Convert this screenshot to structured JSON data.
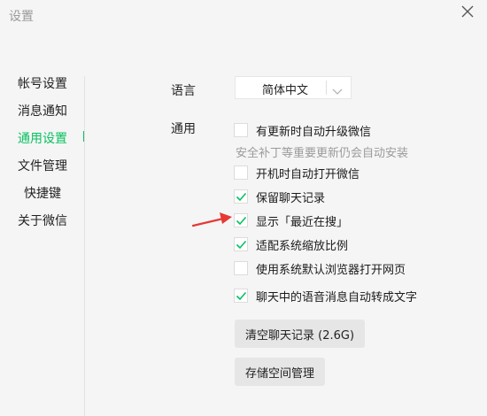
{
  "window": {
    "title": "设置"
  },
  "sidebar": {
    "items": [
      {
        "label": "帐号设置",
        "active": false
      },
      {
        "label": "消息通知",
        "active": false
      },
      {
        "label": "通用设置",
        "active": true
      },
      {
        "label": "文件管理",
        "active": false
      },
      {
        "label": "快捷键",
        "active": false
      },
      {
        "label": "关于微信",
        "active": false
      }
    ]
  },
  "language": {
    "label": "语言",
    "selected": "简体中文"
  },
  "general": {
    "label": "通用",
    "options": [
      {
        "label": "有更新时自动升级微信",
        "checked": false
      },
      {
        "label": "开机时自动打开微信",
        "checked": false
      },
      {
        "label": "保留聊天记录",
        "checked": true
      },
      {
        "label": "显示「最近在搜」",
        "checked": true
      },
      {
        "label": "适配系统缩放比例",
        "checked": true
      },
      {
        "label": "使用系统默认浏览器打开网页",
        "checked": false
      },
      {
        "label": "聊天中的语音消息自动转成文字",
        "checked": true
      }
    ],
    "auto_update_hint": "安全补丁等重要更新仍会自动安装"
  },
  "buttons": {
    "clear_chat": "清空聊天记录 (2.6G)",
    "storage": "存储空间管理"
  },
  "colors": {
    "accent": "#07c160",
    "arrow": "#e53935",
    "background": "#f5f5f5"
  }
}
